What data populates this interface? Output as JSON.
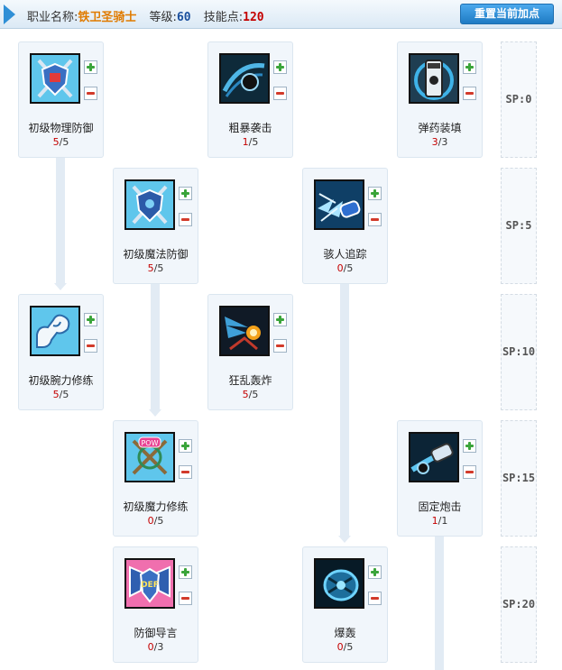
{
  "header": {
    "job_label": "职业名称:",
    "job_name": "铁卫圣骑士",
    "level_label": "等级:",
    "level": "60",
    "sp_label": "技能点:",
    "sp": "120",
    "reset_button": "重置当前加点"
  },
  "skills": [
    {
      "name": "初级物理防御",
      "current": "5",
      "max": "5",
      "icon": "shield-crossed-axes-icon"
    },
    {
      "name": "粗暴袭击",
      "current": "1",
      "max": "5",
      "icon": "charging-knight-icon"
    },
    {
      "name": "弹药装填",
      "current": "3",
      "max": "3",
      "icon": "ammo-canister-icon"
    },
    {
      "name": "初级魔法防御",
      "current": "5",
      "max": "5",
      "icon": "shield-crossed-axes-icon"
    },
    {
      "name": "骇人追踪",
      "current": "0",
      "max": "5",
      "icon": "ice-cannon-icon"
    },
    {
      "name": "初级腕力修练",
      "current": "5",
      "max": "5",
      "icon": "flexed-arm-icon"
    },
    {
      "name": "狂乱轰炸",
      "current": "5",
      "max": "5",
      "icon": "bombardment-icon"
    },
    {
      "name": "初级魔力修练",
      "current": "0",
      "max": "5",
      "icon": "pow-crossed-staffs-icon"
    },
    {
      "name": "固定炮击",
      "current": "1",
      "max": "1",
      "icon": "cannon-shot-icon"
    },
    {
      "name": "防御导言",
      "current": "0",
      "max": "3",
      "icon": "def-shield-icon"
    },
    {
      "name": "爆轰",
      "current": "0",
      "max": "5",
      "icon": "blast-shield-icon"
    }
  ],
  "sp_tiers": [
    "SP:0",
    "SP:5",
    "SP:10",
    "SP:15",
    "SP:20"
  ],
  "colors": {
    "accent": "#2f8fd6",
    "job_name": "#e07b00",
    "level": "#1a4f9e",
    "sp": "#c40000",
    "current_level": "#c40000"
  }
}
